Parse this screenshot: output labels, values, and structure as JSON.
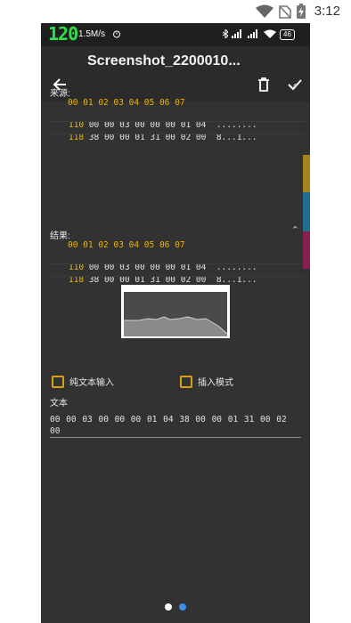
{
  "outer_status": {
    "time": "3:12"
  },
  "inner_status": {
    "speed": "1.5M/s",
    "battery": "46",
    "overlay_number": "120"
  },
  "app_bar": {
    "title": "Screenshot_2200010..."
  },
  "source": {
    "label": "来源:",
    "header": "00 01 02 03 04 05 06 07",
    "rows": [
      {
        "addr": "110",
        "hex": "00 00 03 00 00 00 01 04",
        "ascii": "........"
      },
      {
        "addr": "118",
        "hex": "38 00 00 01 31 00 02 00",
        "ascii": "8...1..."
      }
    ]
  },
  "result": {
    "label": "结果:",
    "header": "00 01 02 03 04 05 06 07",
    "rows": [
      {
        "addr": "110",
        "hex": "00 00 03 00 00 00 01 04",
        "ascii": "........"
      },
      {
        "addr": "118",
        "hex": "38 00 00 01 31 00 02 00",
        "ascii": "8...1..."
      }
    ]
  },
  "options": {
    "plain_text_label": "纯文本输入",
    "insert_mode_label": "插入模式"
  },
  "text_field": {
    "label": "文本",
    "value": "00 00 03 00 00 00 01 04 38 00 00 01 31 00 02 00"
  },
  "colors": {
    "accent": "#f0b400",
    "side_gold": "#a88420",
    "side_blue": "#1e6e8e",
    "side_magenta": "#8a2050",
    "dot_active": "#3d8df0"
  }
}
